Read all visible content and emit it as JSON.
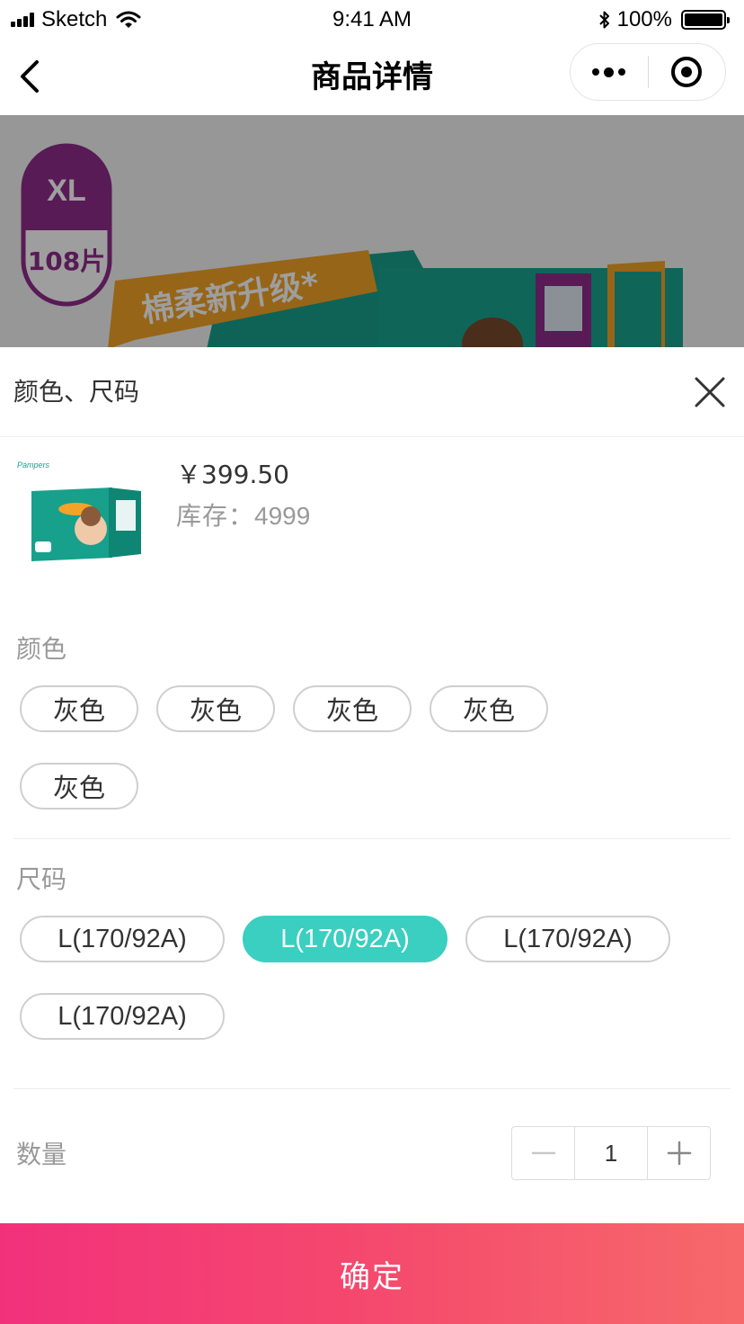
{
  "status_bar": {
    "carrier": "Sketch",
    "time": "9:41 AM",
    "battery_text": "100%",
    "battery_level": 1.0
  },
  "nav": {
    "title": "商品详情"
  },
  "banner": {
    "size_badge": "XL",
    "count_badge": "108片",
    "ribbon_text": "棉柔新升级*",
    "colors": {
      "teal": "#17a08c",
      "purple": "#8e2c8a",
      "orange": "#f3a328"
    }
  },
  "sheet": {
    "title": "颜色、尺码",
    "thumb_brand": "Pampers",
    "price": "￥399.50",
    "stock_label": "库存：",
    "stock_value": "4999",
    "color_section": {
      "label": "颜色",
      "options": [
        "灰色",
        "灰色",
        "灰色",
        "灰色",
        "灰色"
      ]
    },
    "size_section": {
      "label": "尺码",
      "options": [
        "L(170/92A)",
        "L(170/92A)",
        "L(170/92A)",
        "L(170/92A)"
      ],
      "selected_index": 1
    },
    "quantity": {
      "label": "数量",
      "value": "1"
    },
    "confirm_label": "确定"
  },
  "colors": {
    "accent": "#3acfc0",
    "confirm_gradient_start": "#f2317b",
    "confirm_gradient_end": "#f6696a"
  }
}
